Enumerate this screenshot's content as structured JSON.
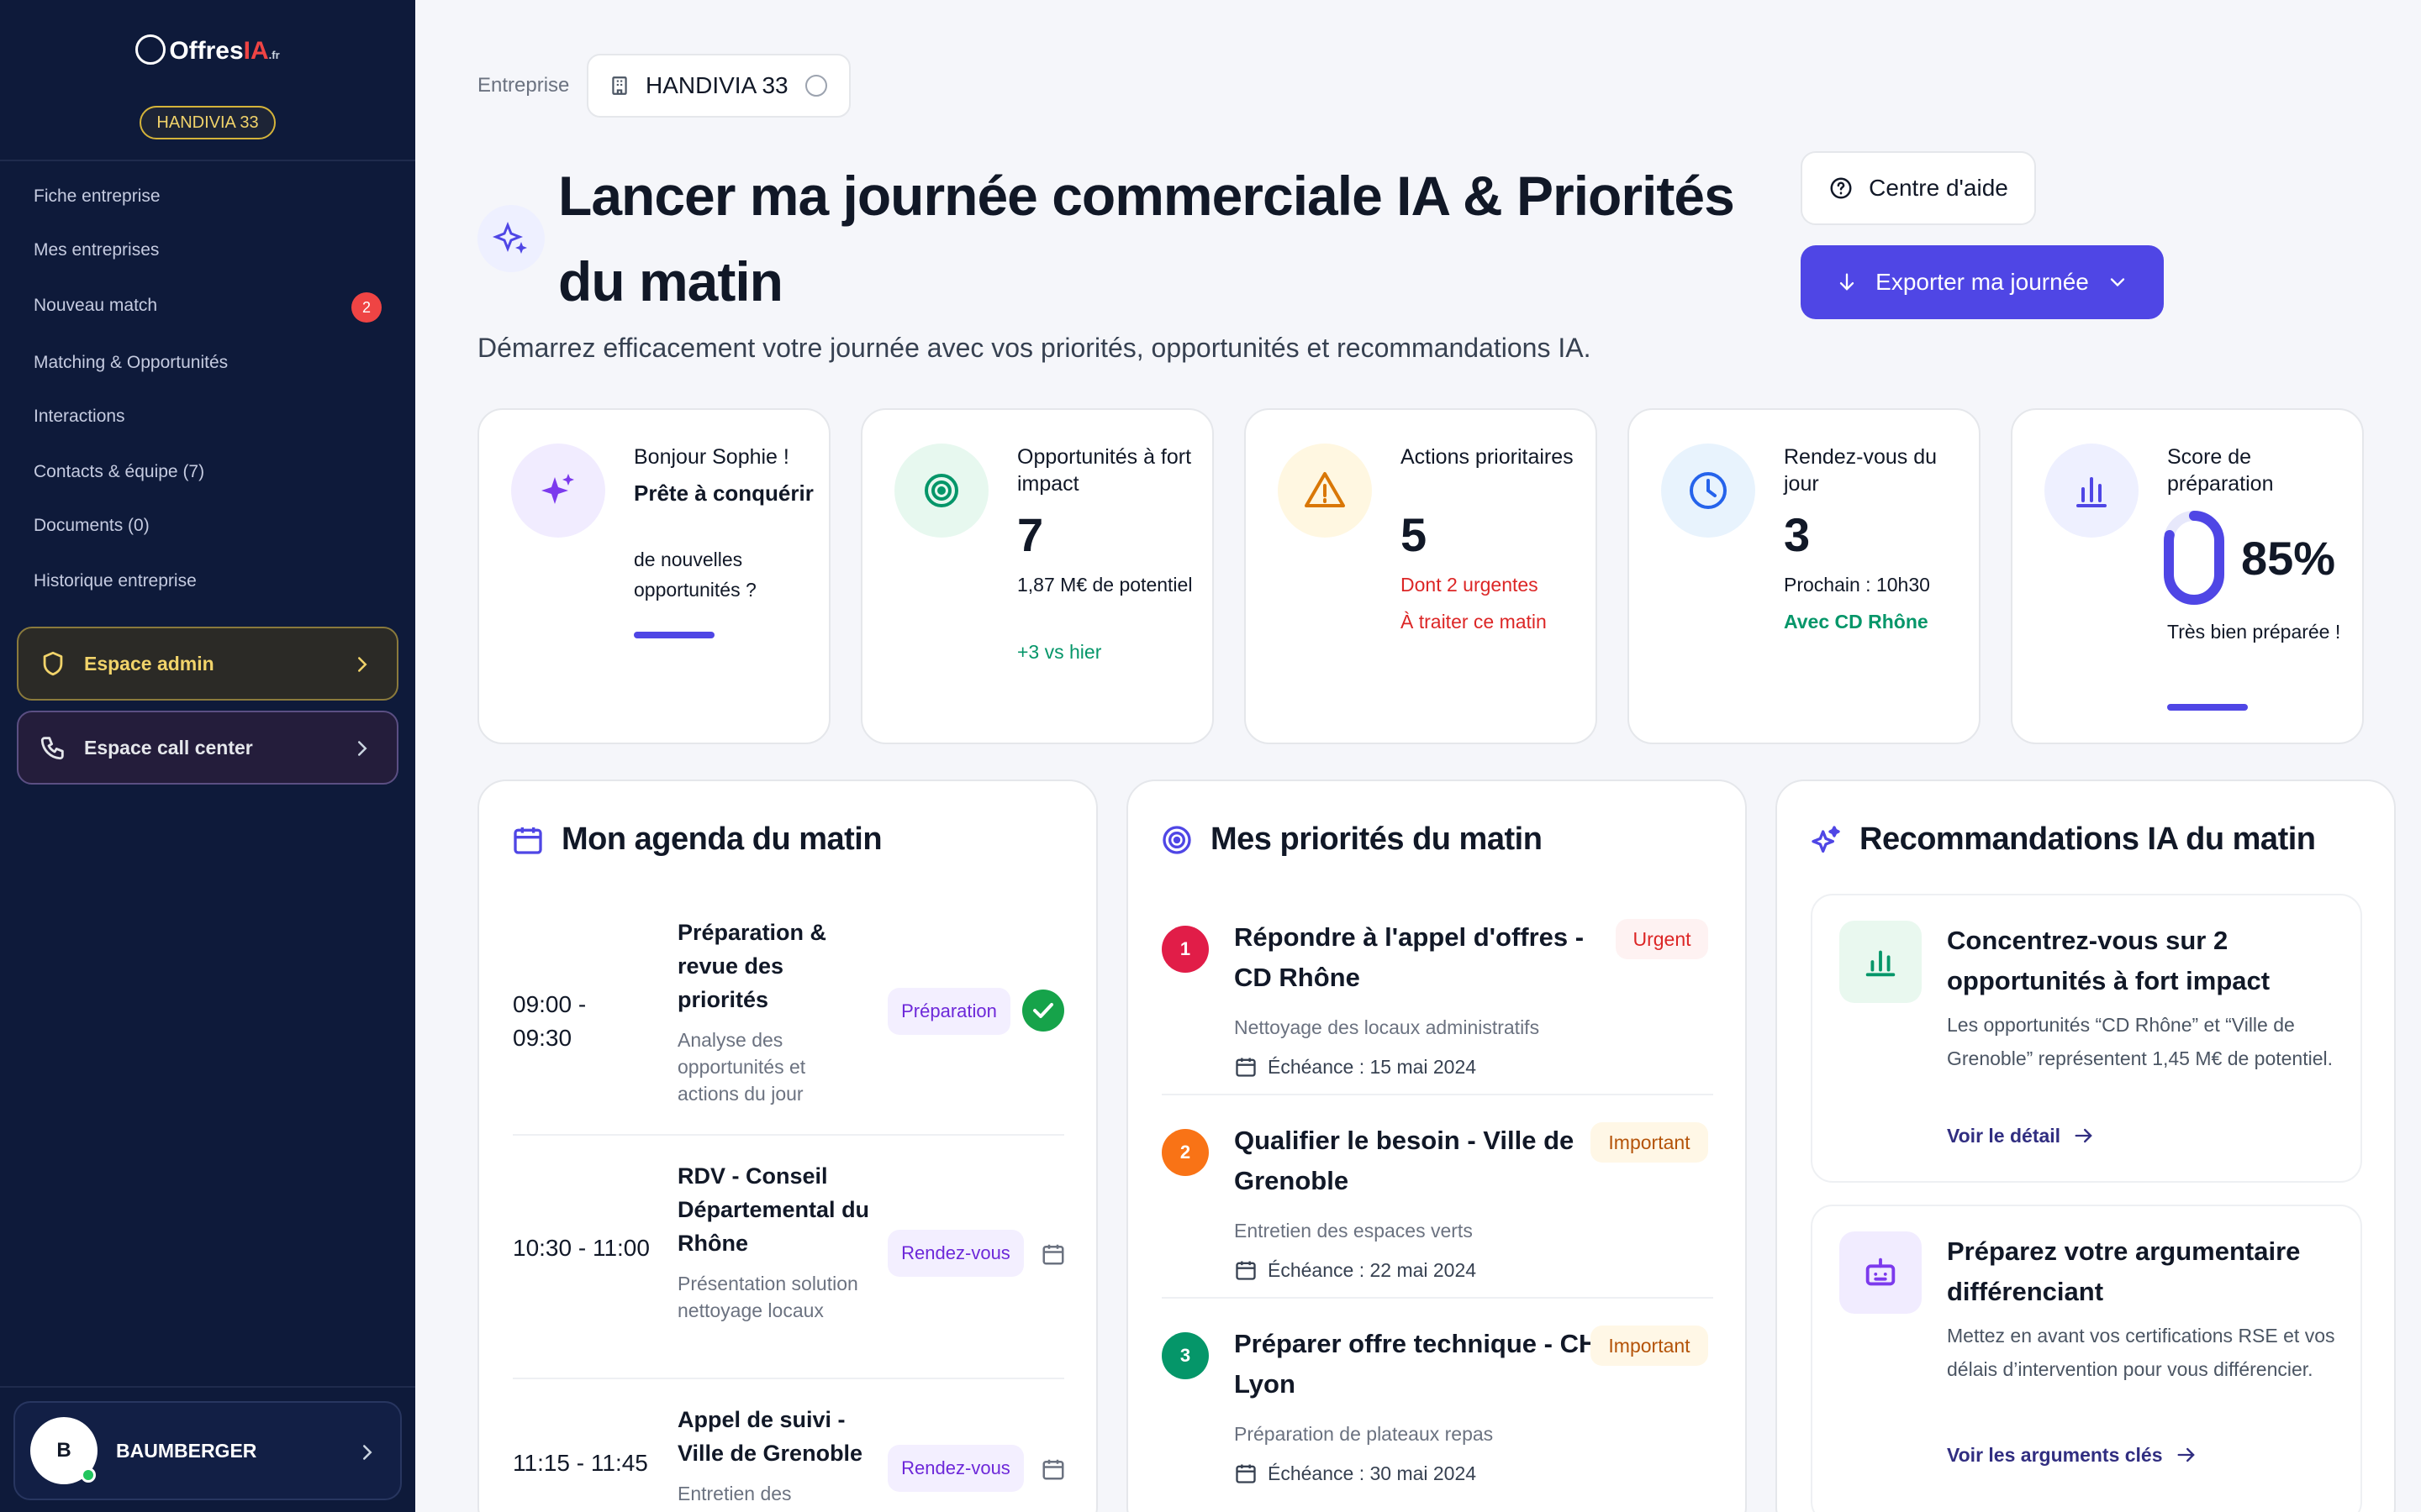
{
  "sidebar": {
    "logo": {
      "name": "Offres",
      "accent": "IA",
      "suffix": ".fr"
    },
    "company_badge": "HANDIVIA 33",
    "nav": [
      {
        "label": "Fiche entreprise"
      },
      {
        "label": "Mes entreprises"
      },
      {
        "label": "Nouveau match",
        "badge": "2"
      },
      {
        "label": "Matching & Opportunités"
      },
      {
        "label": "Interactions"
      },
      {
        "label": "Contacts & équipe (7)"
      },
      {
        "label": "Documents (0)"
      },
      {
        "label": "Historique entreprise"
      }
    ],
    "admin_label": "Espace admin",
    "callcenter_label": "Espace call center",
    "user": {
      "initial": "B",
      "name": "BAUMBERGER"
    }
  },
  "header": {
    "crumb_label": "Entreprise",
    "company_name": "HANDIVIA 33",
    "title": "Lancer ma journée commerciale IA & Priorités du matin",
    "subtitle": "Démarrez efficacement votre journée avec vos priorités, opportunités et recommandations IA.",
    "help_label": "Centre d'aide",
    "export_label": "Exporter ma journée"
  },
  "kpis": {
    "hello": {
      "title": "Bonjour Sophie !",
      "headline": "Prête à conquérir",
      "text": "de nouvelles opportunités ?"
    },
    "opportunities": {
      "title": "Opportunités à fort impact",
      "value": "7",
      "sub": "1,87 M€ de potentiel",
      "delta": "+3 vs hier"
    },
    "actions": {
      "title": "Actions prioritaires",
      "value": "5",
      "line1": "Dont 2 urgentes",
      "line2": "À traiter ce matin"
    },
    "meetings": {
      "title": "Rendez-vous du jour",
      "value": "3",
      "line1": "Prochain : 10h30",
      "line2": "Avec CD Rhône"
    },
    "score": {
      "title": "Score de préparation",
      "value": "85%",
      "caption": "Très bien préparée !",
      "percent": 85
    }
  },
  "agenda": {
    "title": "Mon agenda du matin",
    "items": [
      {
        "time": "09:00 - 09:30",
        "title": "Préparation & revue des priorités",
        "desc": "Analyse des opportunités et actions du jour",
        "tag": "Préparation"
      },
      {
        "time": "10:30 - 11:00",
        "title": "RDV - Conseil Départemental du Rhône",
        "desc": "Présentation solution nettoyage locaux",
        "tag": "Rendez-vous"
      },
      {
        "time": "11:15 - 11:45",
        "title": "Appel de suivi - Ville de Grenoble",
        "desc": "Entretien des",
        "tag": "Rendez-vous"
      }
    ]
  },
  "priorities": {
    "title": "Mes priorités du matin",
    "items": [
      {
        "num": "1",
        "title": "Répondre à l'appel d'offres - CD Rhône",
        "desc": "Nettoyage des locaux administratifs",
        "date": "Échéance : 15 mai 2024",
        "tag": "Urgent"
      },
      {
        "num": "2",
        "title": "Qualifier le besoin - Ville de Grenoble",
        "desc": "Entretien des espaces verts",
        "date": "Échéance : 22 mai 2024",
        "tag": "Important"
      },
      {
        "num": "3",
        "title": "Préparer offre technique - CH Lyon",
        "desc": "Préparation de plateaux repas",
        "date": "Échéance : 30 mai 2024",
        "tag": "Important"
      }
    ]
  },
  "recommendations": {
    "title": "Recommandations IA du matin",
    "items": [
      {
        "title": "Concentrez-vous sur 2 opportunités à fort impact",
        "text": "Les opportunités “CD Rhône” et “Ville de Grenoble” représentent 1,45 M€ de potentiel.",
        "link": "Voir le détail"
      },
      {
        "title": "Préparez votre argumentaire différenciant",
        "text": "Mettez en avant vos certifications RSE et vos délais d’intervention pour vous différencier.",
        "link": "Voir les arguments clés"
      }
    ]
  },
  "colors": {
    "sidebar_bg": "#0e1a3a",
    "accent": "#4f46e5",
    "urgent": "#dc2626",
    "success": "#16a34a",
    "warning": "#b45309"
  }
}
